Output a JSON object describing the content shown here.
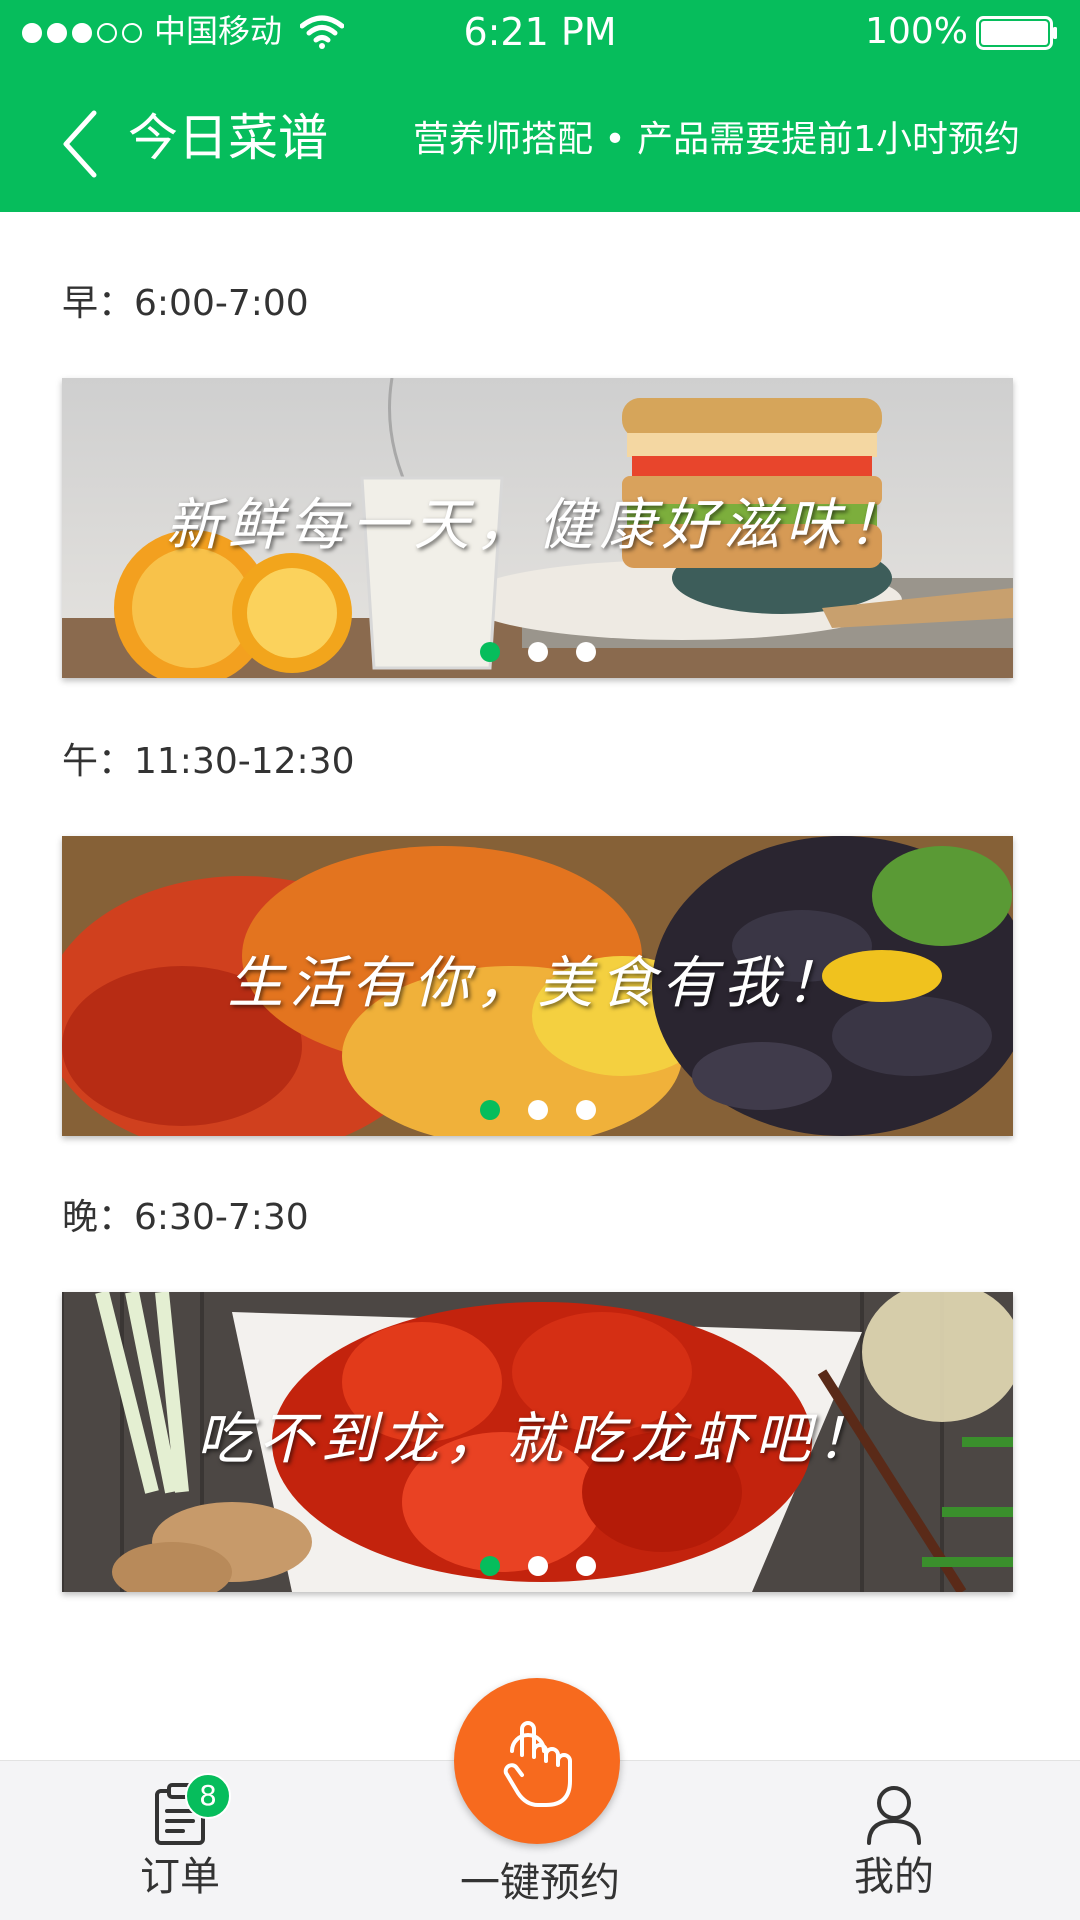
{
  "status_bar": {
    "carrier": "中国移动",
    "time": "6:21 PM",
    "battery": "100%"
  },
  "nav": {
    "back_icon": "chevron-left-icon",
    "title": "今日菜谱",
    "subtitle": "营养师搭配 • 产品需要提前1小时预约"
  },
  "meals": [
    {
      "time": "早：6:00-7:00",
      "caption": "新鲜每一天，健康好滋味！",
      "active_slide": 1,
      "slides": 3
    },
    {
      "time": "午：11:30-12:30",
      "caption": "生活有你，美食有我！",
      "active_slide": 1,
      "slides": 3
    },
    {
      "time": "晚：6:30-7:30",
      "caption": "吃不到龙，就吃龙虾吧！",
      "active_slide": 1,
      "slides": 3
    }
  ],
  "tab_bar": {
    "orders": {
      "label": "订单",
      "badge": "8",
      "icon": "clipboard-icon"
    },
    "book": {
      "label": "一键预约",
      "icon": "tap-hand-icon"
    },
    "me": {
      "label": "我的",
      "icon": "user-icon"
    }
  },
  "colors": {
    "brand_green": "#06bd5c",
    "fab_orange": "#f76a1e",
    "tab_bar_bg": "#f4f4f6"
  }
}
